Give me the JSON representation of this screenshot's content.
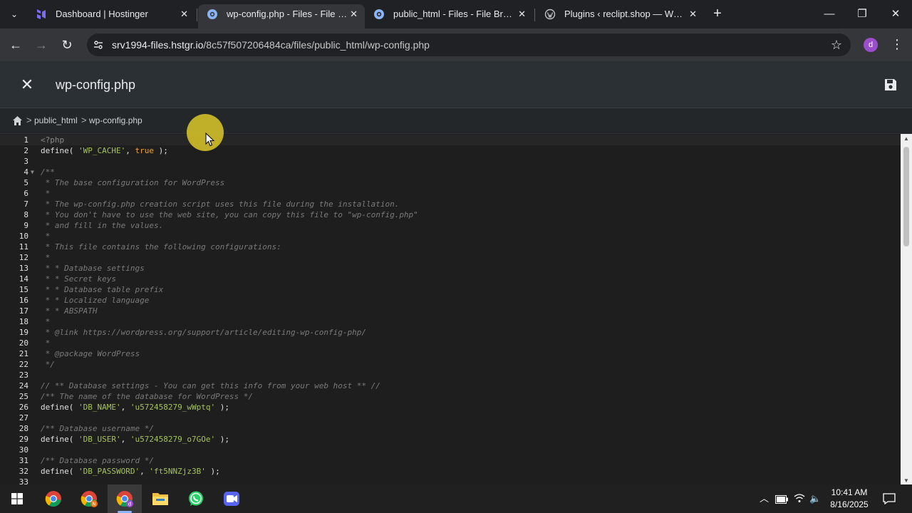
{
  "browser": {
    "tabs": [
      {
        "title": "Dashboard | Hostinger",
        "favicon": "hostinger-icon",
        "active": false
      },
      {
        "title": "wp-config.php - Files - File Browser",
        "favicon": "globe-icon",
        "active": true
      },
      {
        "title": "public_html - Files - File Browser",
        "favicon": "globe-icon",
        "active": false
      },
      {
        "title": "Plugins ‹ reclipt.shop — WordPress",
        "favicon": "wordpress-icon",
        "active": false
      }
    ],
    "address": {
      "host": "srv1994-files.hstgr.io",
      "path": "/8c57f507206484ca/files/public_html/wp-config.php"
    },
    "profile_initial": "d",
    "glyphs": {
      "close": "✕",
      "new_tab": "+",
      "minimize": "—",
      "restore": "❐",
      "back": "←",
      "forward": "→",
      "reload": "↻",
      "star": "☆",
      "menu": "⋮",
      "tab_list": "⌄"
    }
  },
  "editor": {
    "file_title": "wp-config.php",
    "close_glyph": "✕",
    "breadcrumb": [
      "public_html",
      "wp-config.php"
    ],
    "breadcrumb_sep": ">",
    "lines": [
      {
        "n": 1,
        "t": "<?php"
      },
      {
        "n": 2,
        "t": "define( 'WP_CACHE', true );"
      },
      {
        "n": 3,
        "t": ""
      },
      {
        "n": 4,
        "t": "/**"
      },
      {
        "n": 5,
        "t": " * The base configuration for WordPress"
      },
      {
        "n": 6,
        "t": " *"
      },
      {
        "n": 7,
        "t": " * The wp-config.php creation script uses this file during the installation."
      },
      {
        "n": 8,
        "t": " * You don't have to use the web site, you can copy this file to \"wp-config.php\""
      },
      {
        "n": 9,
        "t": " * and fill in the values."
      },
      {
        "n": 10,
        "t": " *"
      },
      {
        "n": 11,
        "t": " * This file contains the following configurations:"
      },
      {
        "n": 12,
        "t": " *"
      },
      {
        "n": 13,
        "t": " * * Database settings"
      },
      {
        "n": 14,
        "t": " * * Secret keys"
      },
      {
        "n": 15,
        "t": " * * Database table prefix"
      },
      {
        "n": 16,
        "t": " * * Localized language"
      },
      {
        "n": 17,
        "t": " * * ABSPATH"
      },
      {
        "n": 18,
        "t": " *"
      },
      {
        "n": 19,
        "t": " * @link https://wordpress.org/support/article/editing-wp-config-php/"
      },
      {
        "n": 20,
        "t": " *"
      },
      {
        "n": 21,
        "t": " * @package WordPress"
      },
      {
        "n": 22,
        "t": " */"
      },
      {
        "n": 23,
        "t": ""
      },
      {
        "n": 24,
        "t": "// ** Database settings - You can get this info from your web host ** //"
      },
      {
        "n": 25,
        "t": "/** The name of the database for WordPress */"
      },
      {
        "n": 26,
        "t": "define( 'DB_NAME', 'u572458279_wWptq' );"
      },
      {
        "n": 27,
        "t": ""
      },
      {
        "n": 28,
        "t": "/** Database username */"
      },
      {
        "n": 29,
        "t": "define( 'DB_USER', 'u572458279_o7GOe' );"
      },
      {
        "n": 30,
        "t": ""
      },
      {
        "n": 31,
        "t": "/** Database password */"
      },
      {
        "n": 32,
        "t": "define( 'DB_PASSWORD', 'ft5NNZjz3B' );"
      },
      {
        "n": 33,
        "t": ""
      }
    ]
  },
  "taskbar": {
    "apps": [
      "windows-start-icon",
      "chrome-icon",
      "chrome-profile-n-icon",
      "chrome-profile-d-icon",
      "file-explorer-icon",
      "whatsapp-icon",
      "video-app-icon"
    ],
    "tray_glyphs": {
      "chevron": "︿",
      "volume": "🔈"
    },
    "time": "10:41 AM",
    "date": "8/16/2025"
  },
  "colors": {
    "accent": "#8ab4f8",
    "code_bg": "#1e1e1e",
    "header_bg": "#2b3034",
    "cursor_halo": "#dcc828"
  }
}
